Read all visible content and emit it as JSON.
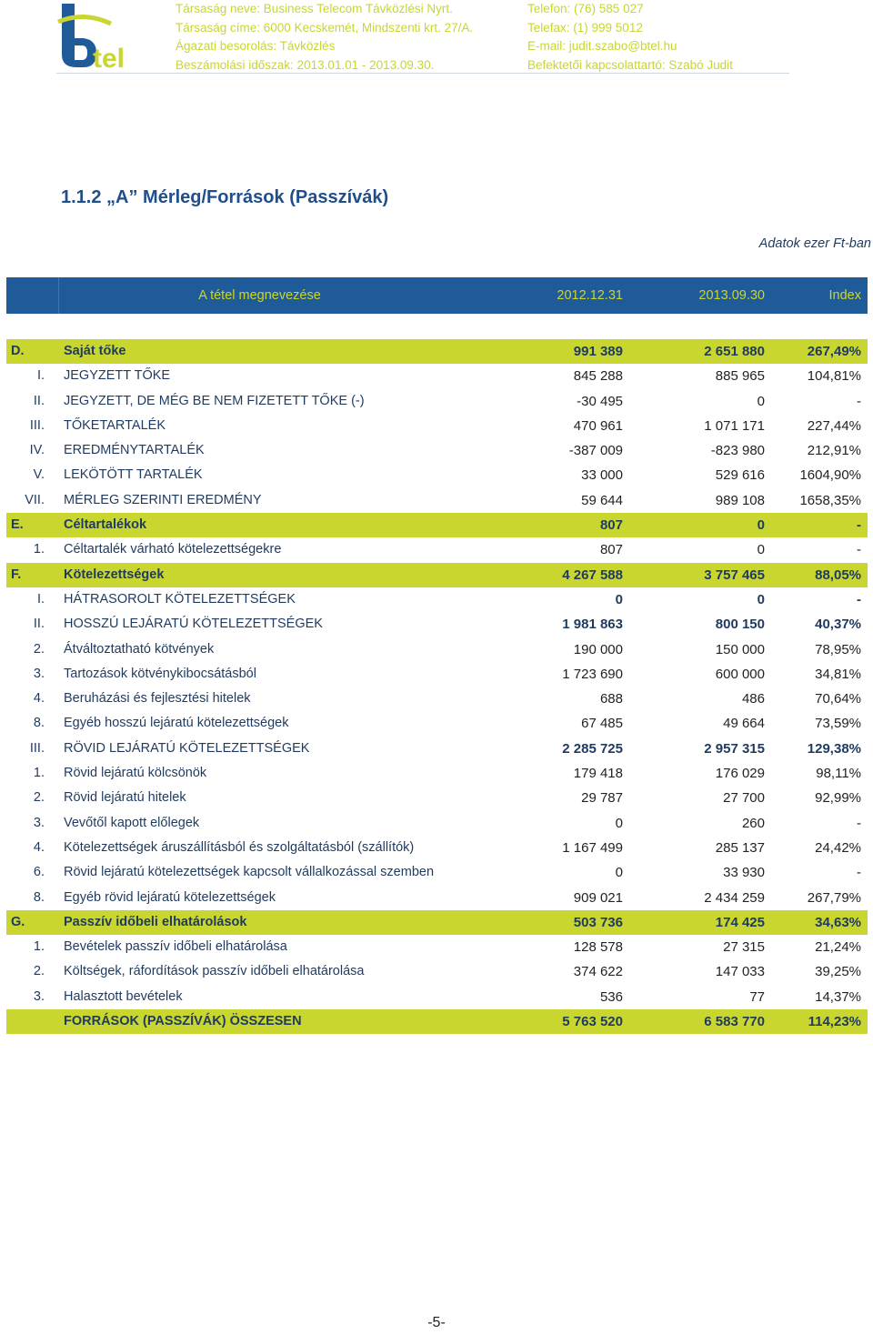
{
  "header": {
    "left": [
      "Társaság neve: Business Telecom Távközlési Nyrt.",
      "Társaság címe: 6000 Kecskemét, Mindszenti krt. 27/A.",
      "Ágazati besorolás: Távközlés",
      "Beszámolási időszak: 2013.01.01 - 2013.09.30."
    ],
    "right": [
      "Telefon: (76) 585 027",
      "Telefax: (1) 999 5012",
      "E-mail: judit.szabo@btel.hu",
      "Befektetői kapcsolattartó: Szabó Judit"
    ],
    "logo_text": "btel",
    "colors": {
      "brand_blue": "#1f5b98",
      "brand_green": "#c9d62f"
    }
  },
  "section_title": "1.1.2 „A” Mérleg/Források (Passzívák)",
  "unit_note": "Adatok ezer Ft-ban",
  "table": {
    "columns": [
      "A tétel megnevezése",
      "2012.12.31",
      "2013.09.30",
      "Index"
    ],
    "rows": [
      {
        "code": "D.",
        "name": "Saját tőke",
        "v1": "991 389",
        "v2": "2 651 880",
        "v3": "267,49%",
        "style": "hl"
      },
      {
        "code": "I.",
        "name": "JEGYZETT TŐKE",
        "v1": "845 288",
        "v2": "885 965",
        "v3": "104,81%",
        "style": ""
      },
      {
        "code": "II.",
        "name": "JEGYZETT, DE MÉG BE NEM FIZETETT TŐKE (-)",
        "v1": "-30 495",
        "v2": "0",
        "v3": "-",
        "style": ""
      },
      {
        "code": "III.",
        "name": "TŐKETARTALÉK",
        "v1": "470 961",
        "v2": "1 071 171",
        "v3": "227,44%",
        "style": ""
      },
      {
        "code": "IV.",
        "name": "EREDMÉNYTARTALÉK",
        "v1": "-387 009",
        "v2": "-823 980",
        "v3": "212,91%",
        "style": ""
      },
      {
        "code": "V.",
        "name": "LEKÖTÖTT TARTALÉK",
        "v1": "33 000",
        "v2": "529 616",
        "v3": "1604,90%",
        "style": ""
      },
      {
        "code": "VII.",
        "name": "MÉRLEG SZERINTI EREDMÉNY",
        "v1": "59 644",
        "v2": "989 108",
        "v3": "1658,35%",
        "style": ""
      },
      {
        "code": "E.",
        "name": "Céltartalékok",
        "v1": "807",
        "v2": "0",
        "v3": "-",
        "style": "hl"
      },
      {
        "code": "1.",
        "name": "Céltartalék várható kötelezettségekre",
        "v1": "807",
        "v2": "0",
        "v3": "-",
        "style": ""
      },
      {
        "code": "F.",
        "name": "Kötelezettségek",
        "v1": "4 267 588",
        "v2": "3 757 465",
        "v3": "88,05%",
        "style": "hl"
      },
      {
        "code": "I.",
        "name": "HÁTRASOROLT KÖTELEZETTSÉGEK",
        "v1": "0",
        "v2": "0",
        "v3": "-",
        "style": "sub"
      },
      {
        "code": "II.",
        "name": "HOSSZÚ LEJÁRATÚ KÖTELEZETTSÉGEK",
        "v1": "1 981 863",
        "v2": "800 150",
        "v3": "40,37%",
        "style": "sub"
      },
      {
        "code": "2.",
        "name": "Átváltoztatható kötvények",
        "v1": "190 000",
        "v2": "150 000",
        "v3": "78,95%",
        "style": ""
      },
      {
        "code": "3.",
        "name": "Tartozások kötvénykibocsátásból",
        "v1": "1 723 690",
        "v2": "600 000",
        "v3": "34,81%",
        "style": ""
      },
      {
        "code": "4.",
        "name": "Beruházási és fejlesztési hitelek",
        "v1": "688",
        "v2": "486",
        "v3": "70,64%",
        "style": ""
      },
      {
        "code": "8.",
        "name": "Egyéb hosszú lejáratú kötelezettségek",
        "v1": "67 485",
        "v2": "49 664",
        "v3": "73,59%",
        "style": ""
      },
      {
        "code": "III.",
        "name": "RÖVID LEJÁRATÚ KÖTELEZETTSÉGEK",
        "v1": "2 285 725",
        "v2": "2 957 315",
        "v3": "129,38%",
        "style": "sub"
      },
      {
        "code": "1.",
        "name": "Rövid lejáratú kölcsönök",
        "v1": "179 418",
        "v2": "176 029",
        "v3": "98,11%",
        "style": ""
      },
      {
        "code": "2.",
        "name": "Rövid lejáratú hitelek",
        "v1": "29 787",
        "v2": "27 700",
        "v3": "92,99%",
        "style": ""
      },
      {
        "code": "3.",
        "name": "Vevőtől kapott előlegek",
        "v1": "0",
        "v2": "260",
        "v3": "-",
        "style": ""
      },
      {
        "code": "4.",
        "name": "Kötelezettségek áruszállításból és szolgáltatásból (szállítók)",
        "v1": "1 167 499",
        "v2": "285 137",
        "v3": "24,42%",
        "style": ""
      },
      {
        "code": "6.",
        "name": "Rövid lejáratú kötelezettségek kapcsolt vállalkozással szemben",
        "v1": "0",
        "v2": "33 930",
        "v3": "-",
        "style": ""
      },
      {
        "code": "8.",
        "name": "Egyéb rövid lejáratú kötelezettségek",
        "v1": "909 021",
        "v2": "2 434 259",
        "v3": "267,79%",
        "style": ""
      },
      {
        "code": "G.",
        "name": "Passzív időbeli elhatárolások",
        "v1": "503 736",
        "v2": "174 425",
        "v3": "34,63%",
        "style": "hl"
      },
      {
        "code": "1.",
        "name": "Bevételek passzív időbeli elhatárolása",
        "v1": "128 578",
        "v2": "27 315",
        "v3": "21,24%",
        "style": ""
      },
      {
        "code": "2.",
        "name": "Költségek, ráfordítások passzív időbeli elhatárolása",
        "v1": "374 622",
        "v2": "147 033",
        "v3": "39,25%",
        "style": ""
      },
      {
        "code": "3.",
        "name": "Halasztott bevételek",
        "v1": "536",
        "v2": "77",
        "v3": "14,37%",
        "style": ""
      },
      {
        "code": "",
        "name": "FORRÁSOK (PASSZÍVÁK) ÖSSZESEN",
        "v1": "5 763 520",
        "v2": "6 583 770",
        "v3": "114,23%",
        "style": "hl"
      }
    ]
  },
  "page_number": "-5-"
}
